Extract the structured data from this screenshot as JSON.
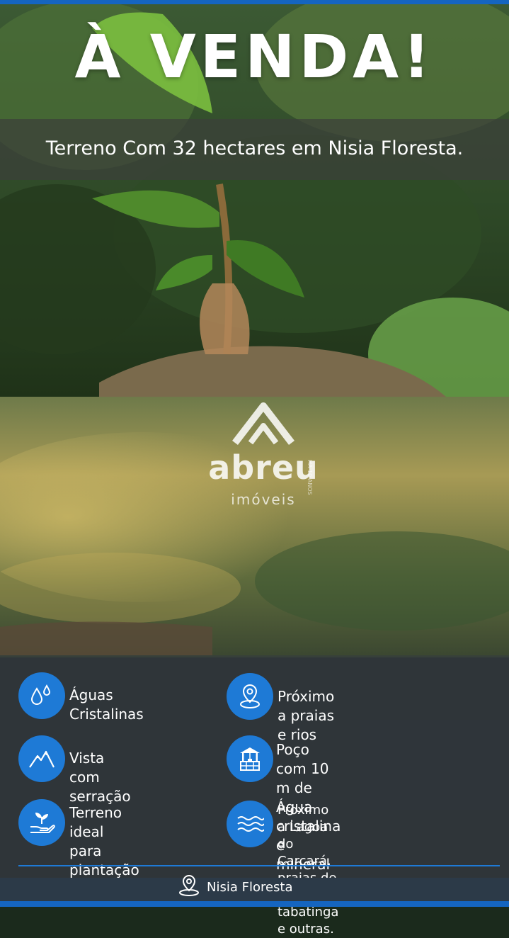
{
  "headline": "À VENDA!",
  "subtitle": "Terreno Com 32 hectares em Nisia Floresta.",
  "watermark": {
    "brand": "abreu",
    "sub": "imóveis",
    "vertical": "HÁ 10 ANOS"
  },
  "features": [
    {
      "icon": "water-drops-icon",
      "text": "Águas Cristalinas"
    },
    {
      "icon": "map-pin-icon",
      "text": "Próximo a praias e rios"
    },
    {
      "icon": "mountain-icon",
      "text": "Vista com serração"
    },
    {
      "icon": "water-well-icon",
      "text": "Poço com 10 m de Água\ncristalina e mineral"
    },
    {
      "icon": "plant-hand-icon",
      "text": "Terreno ideal para\nplantação"
    },
    {
      "icon": "waves-icon",
      "text": "Proximo a Lagoa do Carcará,\npraias de barreta, tabatinga\ne outras."
    }
  ],
  "footer": {
    "icon": "location-pin-icon",
    "location": "Nisia Floresta"
  },
  "colors": {
    "accent": "#1e7ad6",
    "panel": "#2d323a",
    "footer": "#2c3a48"
  }
}
